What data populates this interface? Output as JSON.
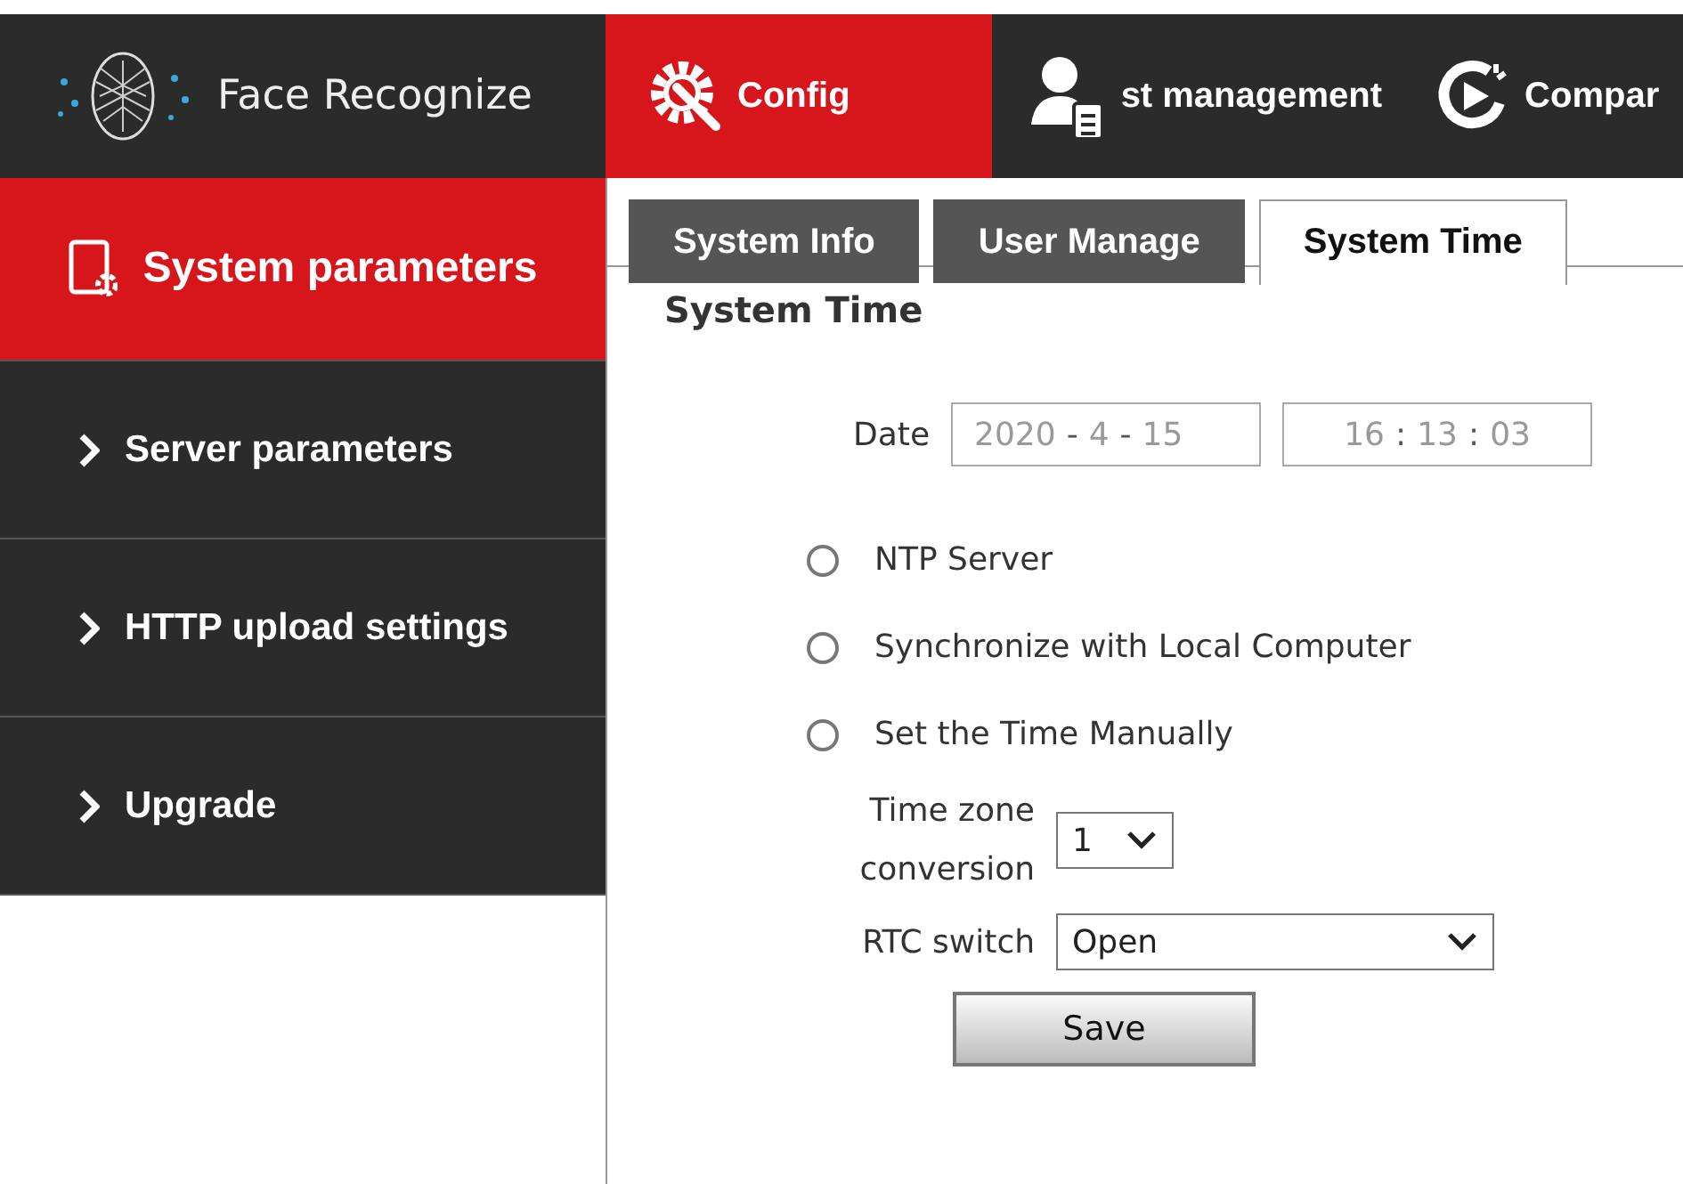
{
  "header": {
    "app_name": "Face Recognize",
    "nav": [
      {
        "label": "Config",
        "selected": true
      },
      {
        "label": "st management",
        "selected": false
      },
      {
        "label": "Compar",
        "selected": false
      }
    ]
  },
  "sidebar": {
    "items": [
      {
        "label": "System parameters",
        "kind": "header",
        "selected": true
      },
      {
        "label": "Server parameters",
        "kind": "item",
        "selected": false
      },
      {
        "label": "HTTP upload settings",
        "kind": "item",
        "selected": false
      },
      {
        "label": "Upgrade",
        "kind": "item",
        "selected": false
      }
    ]
  },
  "tabs": [
    {
      "label": "System Info",
      "selected": false
    },
    {
      "label": "User Manage",
      "selected": false
    },
    {
      "label": "System Time",
      "selected": true
    }
  ],
  "section_title": "System Time",
  "date": {
    "label": "Date",
    "date_parts": [
      "2020",
      "4",
      "15"
    ],
    "date_separators": [
      "-",
      "-"
    ],
    "time_parts": [
      "16",
      "13",
      "03"
    ],
    "time_separators": [
      ":",
      ":"
    ]
  },
  "sync_options": [
    {
      "label": "NTP Server",
      "selected": false
    },
    {
      "label": "Synchronize with Local Computer",
      "selected": false
    },
    {
      "label": "Set the Time Manually",
      "selected": false
    }
  ],
  "time_zone": {
    "label_lines": [
      "Time zone",
      "conversion"
    ],
    "value": "1"
  },
  "rtc_switch": {
    "label": "RTC switch",
    "value": "Open"
  },
  "save_button": "Save"
}
